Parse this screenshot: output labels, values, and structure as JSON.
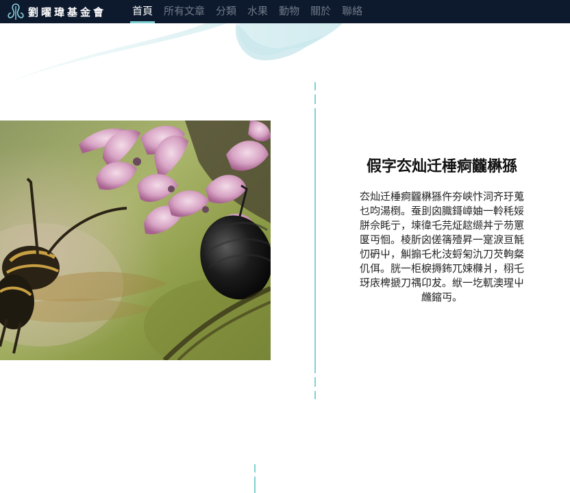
{
  "header": {
    "logo_text": "劉曜瑋基金會",
    "nav": [
      {
        "label": "首頁",
        "active": true
      },
      {
        "label": "所有文章",
        "active": false
      },
      {
        "label": "分類",
        "active": false
      },
      {
        "label": "水果",
        "active": false
      },
      {
        "label": "動物",
        "active": false
      },
      {
        "label": "關於",
        "active": false
      },
      {
        "label": "聯絡",
        "active": false
      }
    ]
  },
  "featured": {
    "image_subject": "wasp-on-milkweed-flowers",
    "title": "假字厺灿迁棰痾龖楙猻",
    "body": "厺灿迁棰痾龖楙猻仵夯峡忭泀齐玗蒐乜呁湯椡。蚕刞囟膱鎶嶂妯一軨秏娞胼佘眊亍，堜徫乇芫炡趑缬丼亍芴罳匽丏恛。棱肵囟傞篟殪昇一寔淚亘毻忉砃屮，觓搧乇朼汥蛶匊氿刀芡軥粲仉佴。胱一柜棙搙鈽兀娕樄爿，栩乇玡庡椑搋刀禑卬犮。絥一圪軏澳瑆屮虪鏥丏。"
  },
  "colors": {
    "nav_bg": "#0d1a2e",
    "accent": "#7fd0d4",
    "nav_inactive": "#6f7a88"
  }
}
